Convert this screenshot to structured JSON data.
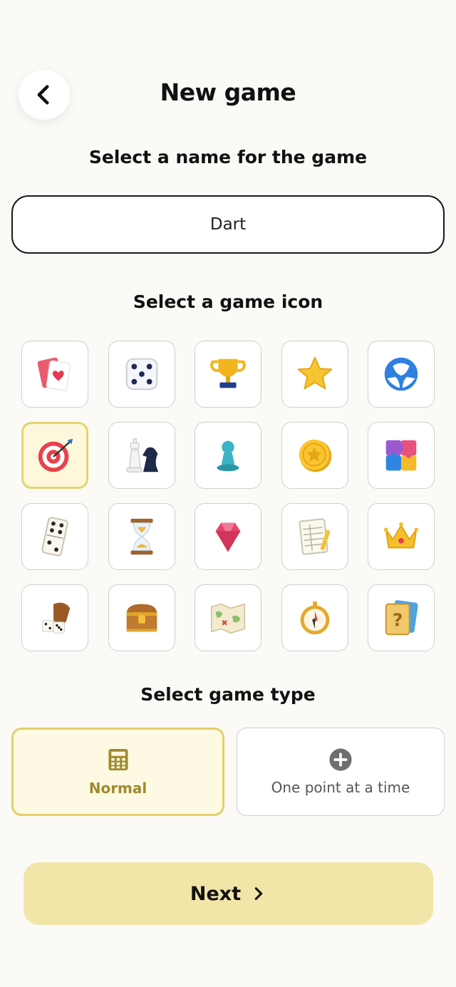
{
  "header": {
    "title": "New game",
    "back_icon": "chevron-left-icon"
  },
  "name_section": {
    "label": "Select a name for the game",
    "value": "Dart"
  },
  "icon_section": {
    "label": "Select a game icon",
    "selected": "target-icon",
    "icons": [
      "playing-cards-icon",
      "dice-icon",
      "trophy-icon",
      "star-icon",
      "ball-icon",
      "target-icon",
      "chess-pieces-icon",
      "pawn-icon",
      "coin-icon",
      "puzzle-icon",
      "domino-icon",
      "hourglass-icon",
      "gem-icon",
      "scoresheet-icon",
      "crown-icon",
      "dice-cup-icon",
      "treasure-chest-icon",
      "map-icon",
      "compass-icon",
      "mystery-card-icon"
    ]
  },
  "type_section": {
    "label": "Select game type",
    "options": [
      {
        "label": "Normal",
        "icon": "calculator-icon",
        "selected": true
      },
      {
        "label": "One point at a time",
        "icon": "plus-circle-icon",
        "selected": false
      }
    ]
  },
  "footer": {
    "next_label": "Next",
    "next_icon": "chevron-right-icon"
  },
  "colors": {
    "accent_gold": "#e3cf6a",
    "button_bg": "#f2e5a8",
    "selected_text": "#a08a2e"
  }
}
